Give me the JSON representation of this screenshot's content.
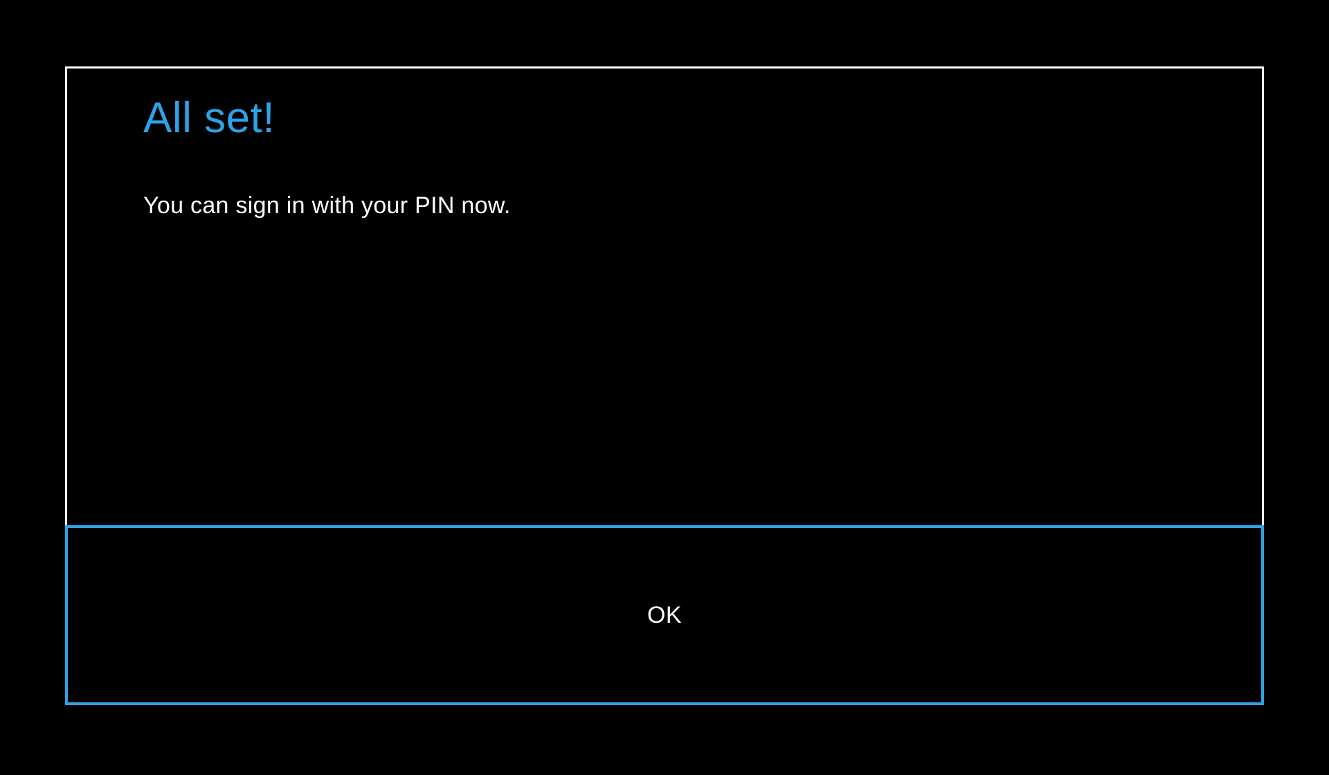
{
  "dialog": {
    "title": "All set!",
    "message": "You can sign in with your PIN now.",
    "ok_label": "OK"
  },
  "colors": {
    "accent": "#2ea2e6",
    "background": "#000000",
    "text": "#ffffff",
    "border": "#ffffff"
  }
}
